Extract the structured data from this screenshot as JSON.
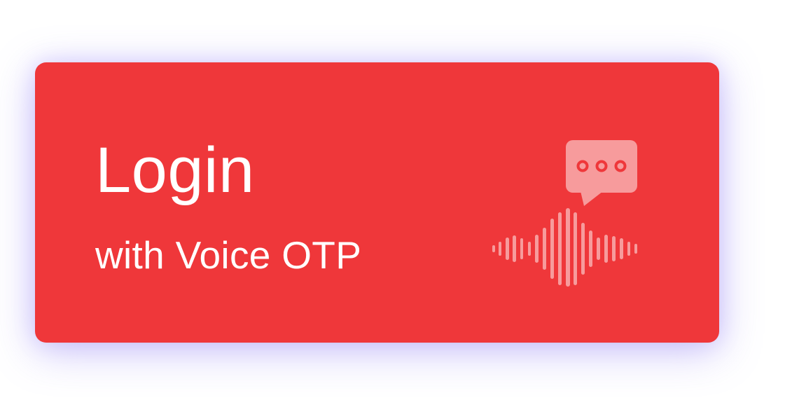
{
  "card": {
    "title": "Login",
    "subtitle": "with Voice OTP",
    "background_color": "#EF373A",
    "icon_tint_color": "#F79B9C",
    "icon": "voice-otp-icon",
    "icon_parts": [
      "chat-bubble-icon",
      "sound-wave-icon"
    ]
  }
}
